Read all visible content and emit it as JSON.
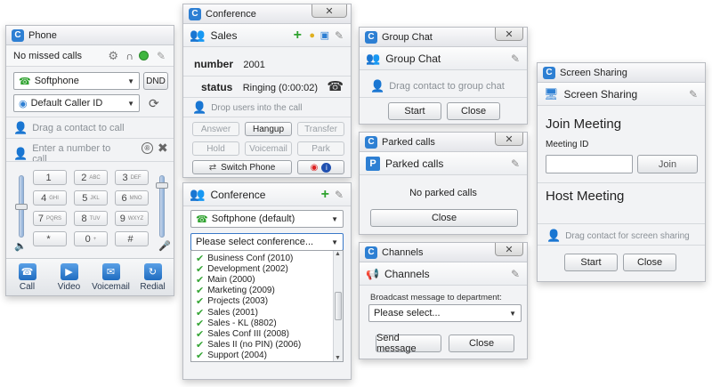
{
  "phone": {
    "title": "Phone",
    "missed_calls": "No missed calls",
    "line_select": "Softphone",
    "dnd": "DND",
    "caller_id_select": "Default Caller ID",
    "drag_hint": "Drag a contact to call",
    "number_placeholder": "Enter a number to call",
    "keys": [
      {
        "digit": "1",
        "letters": ""
      },
      {
        "digit": "2",
        "letters": "ABC"
      },
      {
        "digit": "3",
        "letters": "DEF"
      },
      {
        "digit": "4",
        "letters": "GHI"
      },
      {
        "digit": "5",
        "letters": "JKL"
      },
      {
        "digit": "6",
        "letters": "MNO"
      },
      {
        "digit": "7",
        "letters": "PQRS"
      },
      {
        "digit": "8",
        "letters": "TUV"
      },
      {
        "digit": "9",
        "letters": "WXYZ"
      },
      {
        "digit": "*",
        "letters": ""
      },
      {
        "digit": "0",
        "letters": "+"
      },
      {
        "digit": "#",
        "letters": ""
      }
    ],
    "actions": [
      "Call",
      "Video",
      "Voicemail",
      "Redial"
    ]
  },
  "conference_call": {
    "title": "Conference",
    "panel_title": "Sales",
    "number_label": "number",
    "number_value": "2001",
    "status_label": "status",
    "status_value": "Ringing (0:00:02)",
    "drop_hint": "Drop users into the call",
    "buttons": [
      "Answer",
      "Hangup",
      "Transfer",
      "Hold",
      "Voicemail",
      "Park"
    ],
    "switch_phone": "Switch Phone"
  },
  "conference_list": {
    "title": "Conference",
    "phone_select": "Softphone (default)",
    "conf_select": "Please select conference...",
    "items": [
      "Business Conf (2010)",
      "Development (2002)",
      "Main (2000)",
      "Marketing (2009)",
      "Projects (2003)",
      "Sales (2001)",
      "Sales - KL (8802)",
      "Sales Conf III (2008)",
      "Sales II (no PIN) (2006)",
      "Support (2004)"
    ]
  },
  "group_chat": {
    "title": "Group Chat",
    "panel_title": "Group Chat",
    "hint": "Drag contact to group chat",
    "start": "Start",
    "close": "Close"
  },
  "parked": {
    "title": "Parked calls",
    "panel_title": "Parked calls",
    "empty": "No parked calls",
    "close": "Close"
  },
  "channels": {
    "title": "Channels",
    "panel_title": "Channels",
    "broadcast_label": "Broadcast message to department:",
    "select": "Please select...",
    "send": "Send message",
    "close": "Close"
  },
  "screen_sharing": {
    "title": "Screen Sharing",
    "panel_title": "Screen Sharing",
    "join_heading": "Join Meeting",
    "meeting_id_label": "Meeting ID",
    "join": "Join",
    "host_heading": "Host Meeting",
    "hint": "Drag contact for screen sharing",
    "start": "Start",
    "close": "Close"
  },
  "colors": {
    "accent_blue": "#2d7fd3",
    "status_green": "#2fa22f",
    "window_bg": "#f2f3f5"
  }
}
